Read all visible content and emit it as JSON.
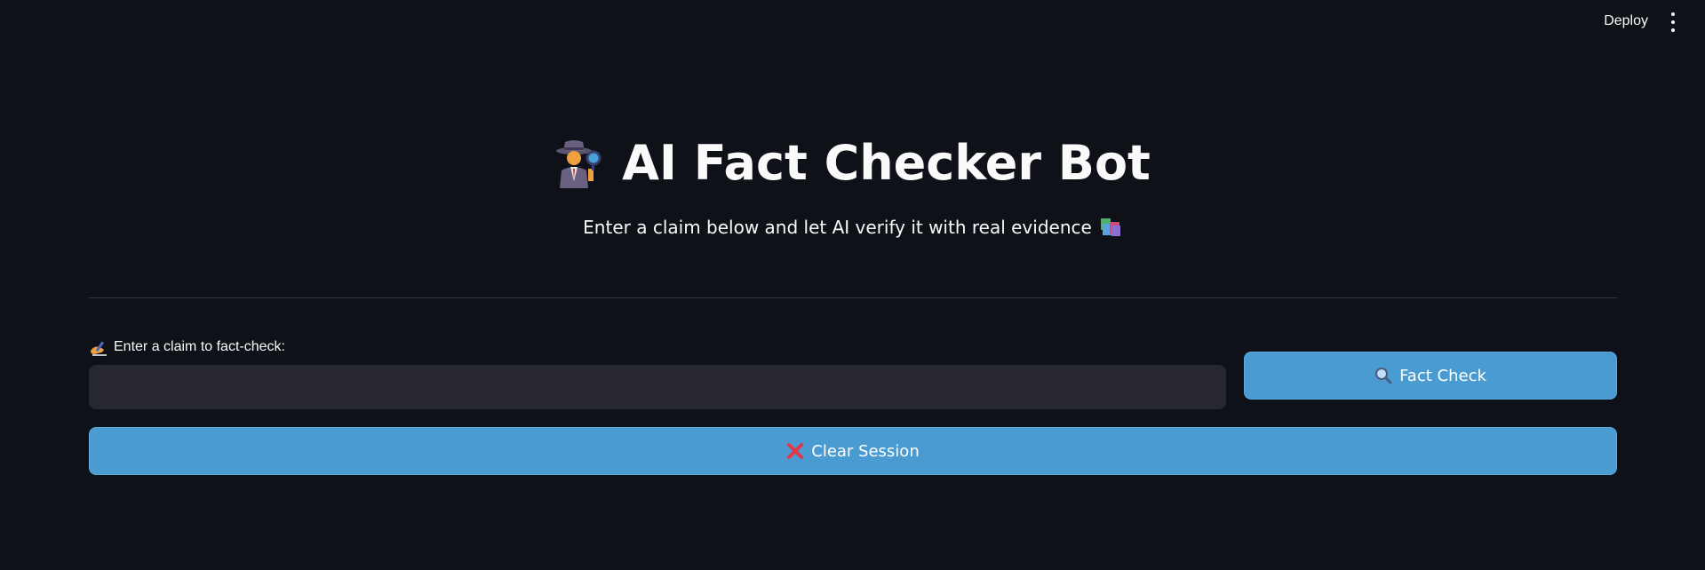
{
  "header": {
    "deploy_label": "Deploy",
    "menu_icon": "kebab-menu-icon"
  },
  "hero": {
    "title_icon": "detective-icon",
    "title": "AI Fact Checker Bot",
    "subtitle": "Enter a claim below and let AI verify it with real evidence",
    "subtitle_icon": "books-icon"
  },
  "form": {
    "claim_label_icon": "writing-hand-icon",
    "claim_label": "Enter a claim to fact-check:",
    "claim_value": "",
    "claim_placeholder": "",
    "fact_check_icon": "magnifying-glass-icon",
    "fact_check_label": "Fact Check",
    "clear_icon": "red-x-icon",
    "clear_label": "Clear Session"
  },
  "colors": {
    "background": "#0e1117",
    "input_background": "#262730",
    "button_blue": "#4a9bd1",
    "divider": "#31333f",
    "text": "#fafafa"
  }
}
